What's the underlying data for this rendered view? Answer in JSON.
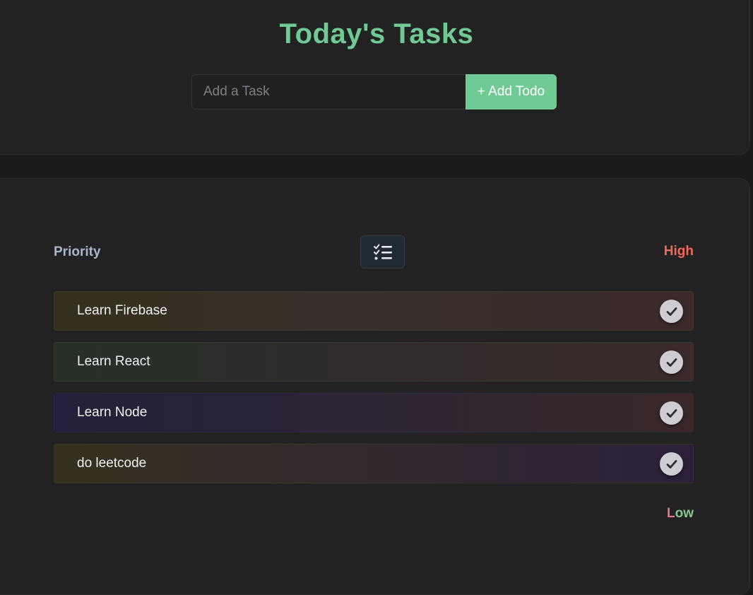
{
  "header": {
    "title": "Today's Tasks"
  },
  "add_form": {
    "placeholder": "Add a Task",
    "value": "",
    "button_label": "+ Add Todo"
  },
  "list": {
    "priority_label": "Priority",
    "sort_icon": "checklist-icon",
    "high_label": "High",
    "low_label_first": "L",
    "low_label_rest": "ow",
    "todos": [
      {
        "text": "Learn Firebase",
        "icon": "check-icon"
      },
      {
        "text": "Learn React",
        "icon": "check-icon"
      },
      {
        "text": "Learn Node",
        "icon": "check-icon"
      },
      {
        "text": "do leetcode",
        "icon": "check-icon"
      }
    ]
  },
  "colors": {
    "accent": "#6fcb93",
    "high": "#ef6a58",
    "low_pink": "#e7768d",
    "low_green": "#86c68f",
    "background": "#1b1b1b",
    "card": "#222222"
  }
}
